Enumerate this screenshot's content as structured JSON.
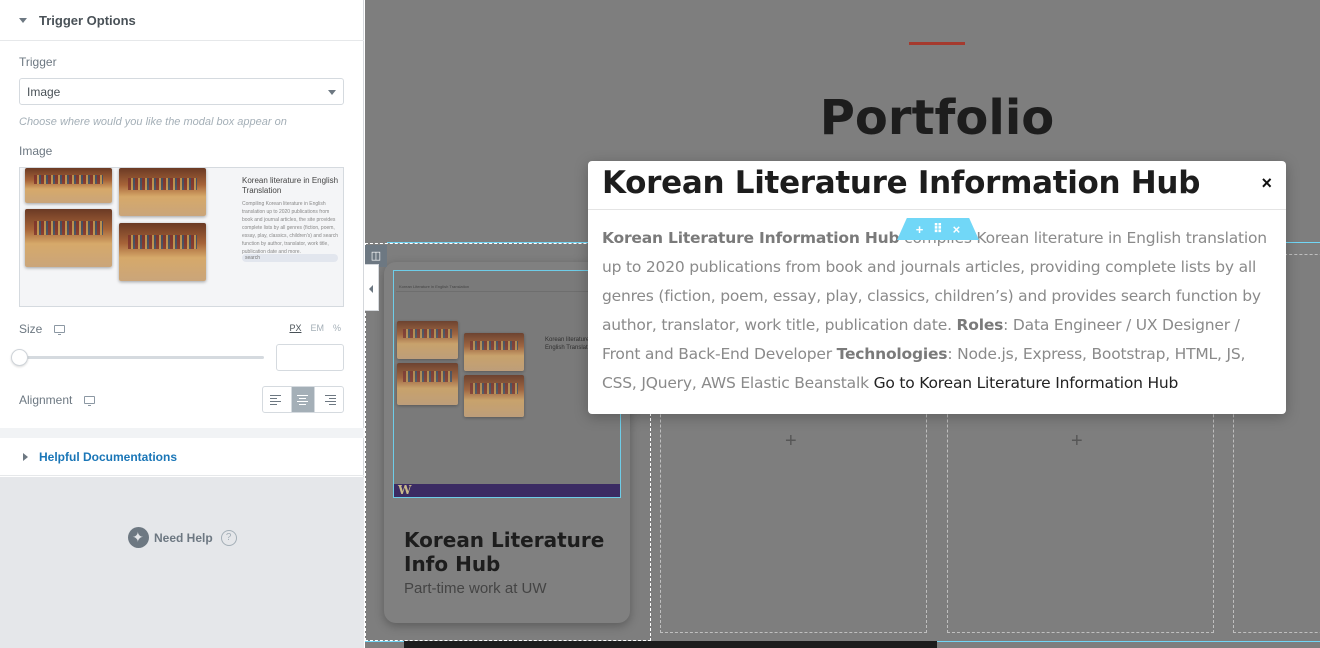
{
  "panel": {
    "section_title": "Trigger Options",
    "trigger_label": "Trigger",
    "trigger_value": "Image",
    "trigger_hint": "Choose where would you like the modal box appear on",
    "image_label": "Image",
    "thumb": {
      "title": "Korean literature in English Translation",
      "text": "Compiling Korean literature in English translation up to 2020 publications from book and journal articles, the site provides complete lists by all genres (fiction, poem, essay, play, classics, children's) and search function by author, translator, work title, publication date and more.",
      "search": "search"
    },
    "size_label": "Size",
    "units": [
      "PX",
      "EM",
      "%"
    ],
    "alignment_label": "Alignment",
    "help_docs_label": "Helpful Documentations",
    "need_help_label": "Need Help",
    "help_q": "?"
  },
  "canvas": {
    "heading": "Portfolio",
    "plus": "+",
    "card": {
      "title": "Korean Literature Info Hub",
      "subtitle": "Part-time work at UW",
      "shot_nav": "Korean Literature in English Translation",
      "shot_text": "Korean literature in English Translation",
      "shot_logo": "W"
    },
    "modal": {
      "title": "Korean Literature Information Hub",
      "close": "×",
      "body_lead": "Korean Literature Information Hub",
      "body_text": " compiles Korean literature in English translation up to 2020 publications from book and journals articles, providing complete lists by all genres (fiction, poem, essay, play, classics, children’s) and provides search function by author, translator, work title, publication date. ",
      "roles_label": "Roles",
      "roles_value": ": Data Engineer / UX Designer / Front and Back-End Developer ",
      "tech_label": "Technologies",
      "tech_value": ": Node.js, Express, Bootstrap, HTML, JS, CSS, JQuery, AWS Elastic Beanstalk ",
      "link": "Go to Korean Literature Information Hub"
    },
    "handle": {
      "add": "+",
      "move": "⠿",
      "remove": "×"
    },
    "edit_icon": "✎",
    "column_icon": "◫"
  }
}
